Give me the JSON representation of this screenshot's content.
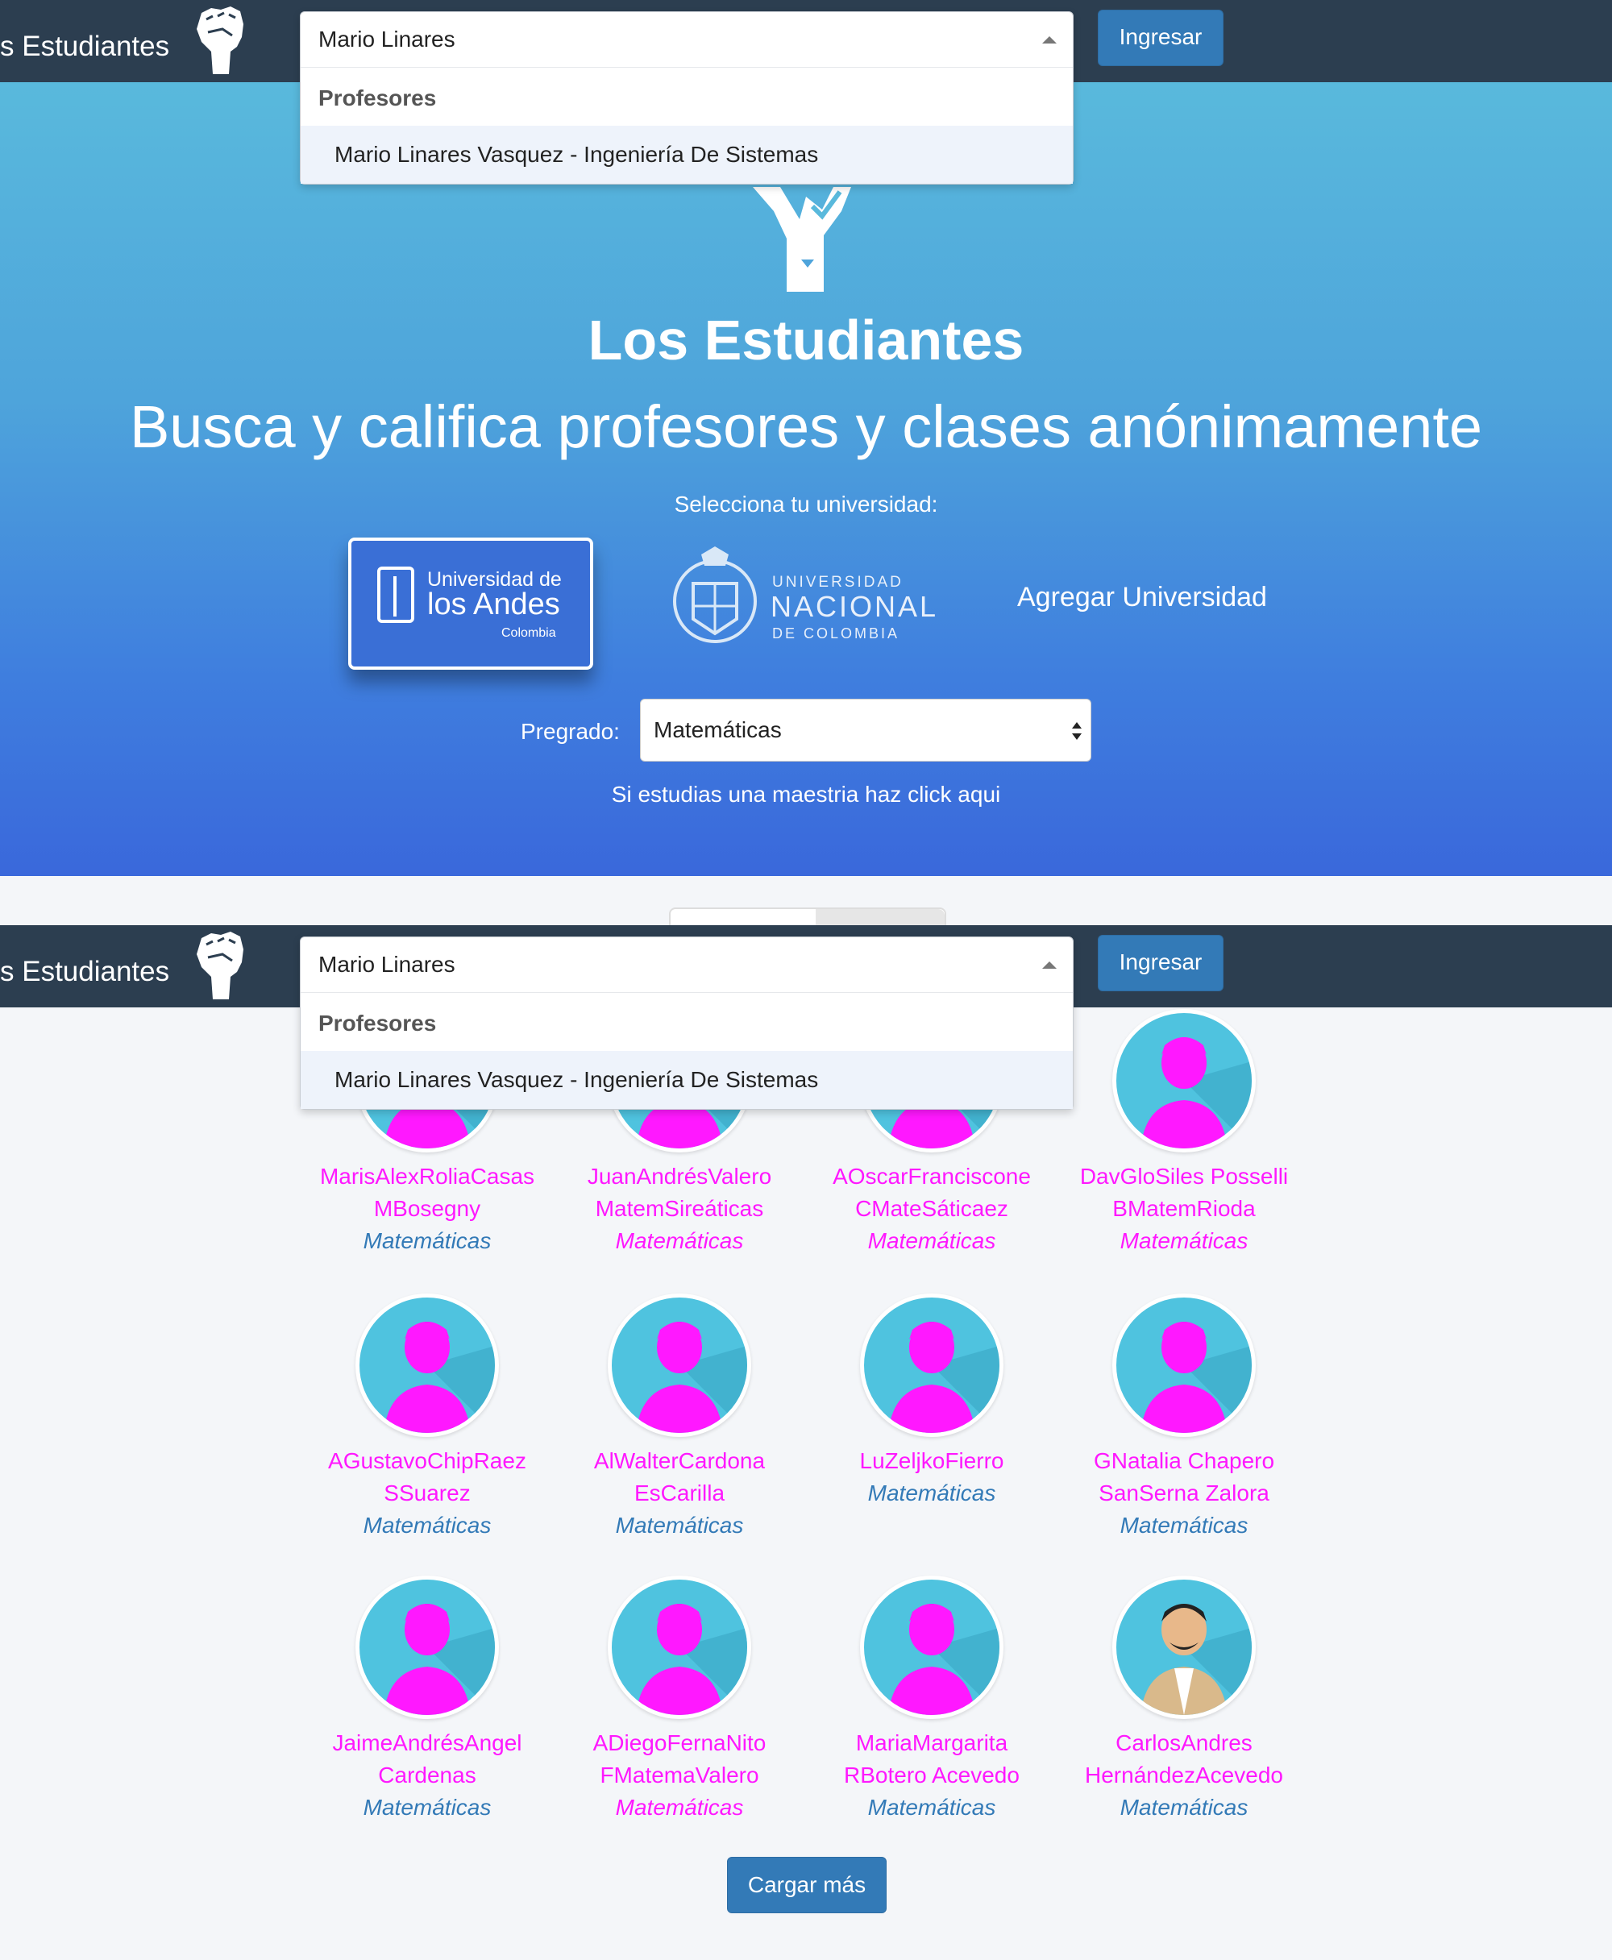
{
  "brand": {
    "name": "s Estudiantes"
  },
  "search": {
    "value": "Mario Linares",
    "group_label": "Profesores",
    "option": "Mario Linares Vasquez - Ingeniería De Sistemas"
  },
  "header": {
    "login_label": "Ingresar"
  },
  "hero": {
    "title": "Los Estudiantes",
    "subtitle": "Busca y califica profesores y clases anónimamente",
    "select_university": "Selecciona tu universidad:",
    "andes": {
      "line1": "Universidad de",
      "line2": "los Andes",
      "line3": "Colombia"
    },
    "nacional": {
      "line1": "UNIVERSIDAD",
      "line2": "NACIONAL",
      "line3": "DE COLOMBIA"
    },
    "add_university": "Agregar Universidad",
    "pregrado_label": "Pregrado:",
    "pregrado_value": "Matemáticas",
    "maestria_link": "Si estudias una maestria haz click aqui"
  },
  "colors": {
    "nav": "#2c3e50",
    "primary": "#337ab7",
    "magenta": "#ff18ff",
    "dept_blue": "#337ab7",
    "avatar_bg": "#4fc3df"
  },
  "professors": [
    {
      "name1": "MarisAlexRoliaCasas",
      "name2": "MBosegny",
      "dept": "Matemáticas",
      "dept_color": "#337ab7"
    },
    {
      "name1": "JuanAndrésValero",
      "name2": "MatemSireáticas",
      "dept": "Matemáticas",
      "dept_color": "#ff18ff"
    },
    {
      "name1": "AOscarFranciscone",
      "name2": "CMateSáticaez",
      "dept": "Matemáticas",
      "dept_color": "#ff18ff"
    },
    {
      "name1": "DavGloSiles Posselli",
      "name2": "BMatemRioda",
      "dept": "Matemáticas",
      "dept_color": "#ff18ff"
    },
    {
      "name1": "AGustavoChipRaez",
      "name2": "SSuarez",
      "dept": "Matemáticas",
      "dept_color": "#337ab7"
    },
    {
      "name1": "AlWalterCardona",
      "name2": "EsCarilla",
      "dept": "Matemáticas",
      "dept_color": "#337ab7"
    },
    {
      "name1": "LuZeljkoFierro",
      "name2": "",
      "dept": "Matemáticas",
      "dept_color": "#337ab7"
    },
    {
      "name1": "GNatalia Chapero",
      "name2": "SanSerna Zalora",
      "dept": "Matemáticas",
      "dept_color": "#337ab7"
    },
    {
      "name1": "JaimeAndrésAngel",
      "name2": "Cardenas",
      "dept": "Matemáticas",
      "dept_color": "#337ab7"
    },
    {
      "name1": "ADiegoFernaNito",
      "name2": "FMatemaValero",
      "dept": "Matemáticas",
      "dept_color": "#ff18ff"
    },
    {
      "name1": "MariaMargarita",
      "name2": "RBotero Acevedo",
      "dept": "Matemáticas",
      "dept_color": "#337ab7"
    },
    {
      "name1": "CarlosAndres",
      "name2": "HernándezAcevedo",
      "dept": "Matemáticas",
      "dept_color": "#337ab7"
    }
  ],
  "load_more": "Cargar más"
}
